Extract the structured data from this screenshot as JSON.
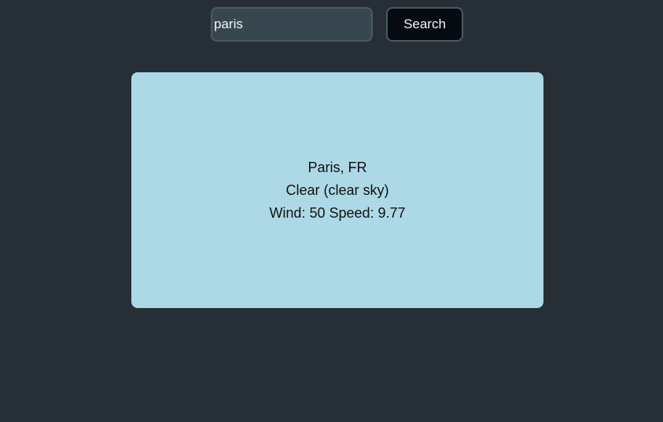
{
  "search": {
    "value": "paris",
    "button_label": "Search"
  },
  "weather": {
    "location": "Paris, FR",
    "condition": "Clear (clear sky)",
    "wind": "Wind: 50 Speed: 9.77"
  },
  "colors": {
    "background": "#262f36",
    "input_background": "#37464f",
    "button_background": "#050b11",
    "card_background": "#add8e6"
  }
}
